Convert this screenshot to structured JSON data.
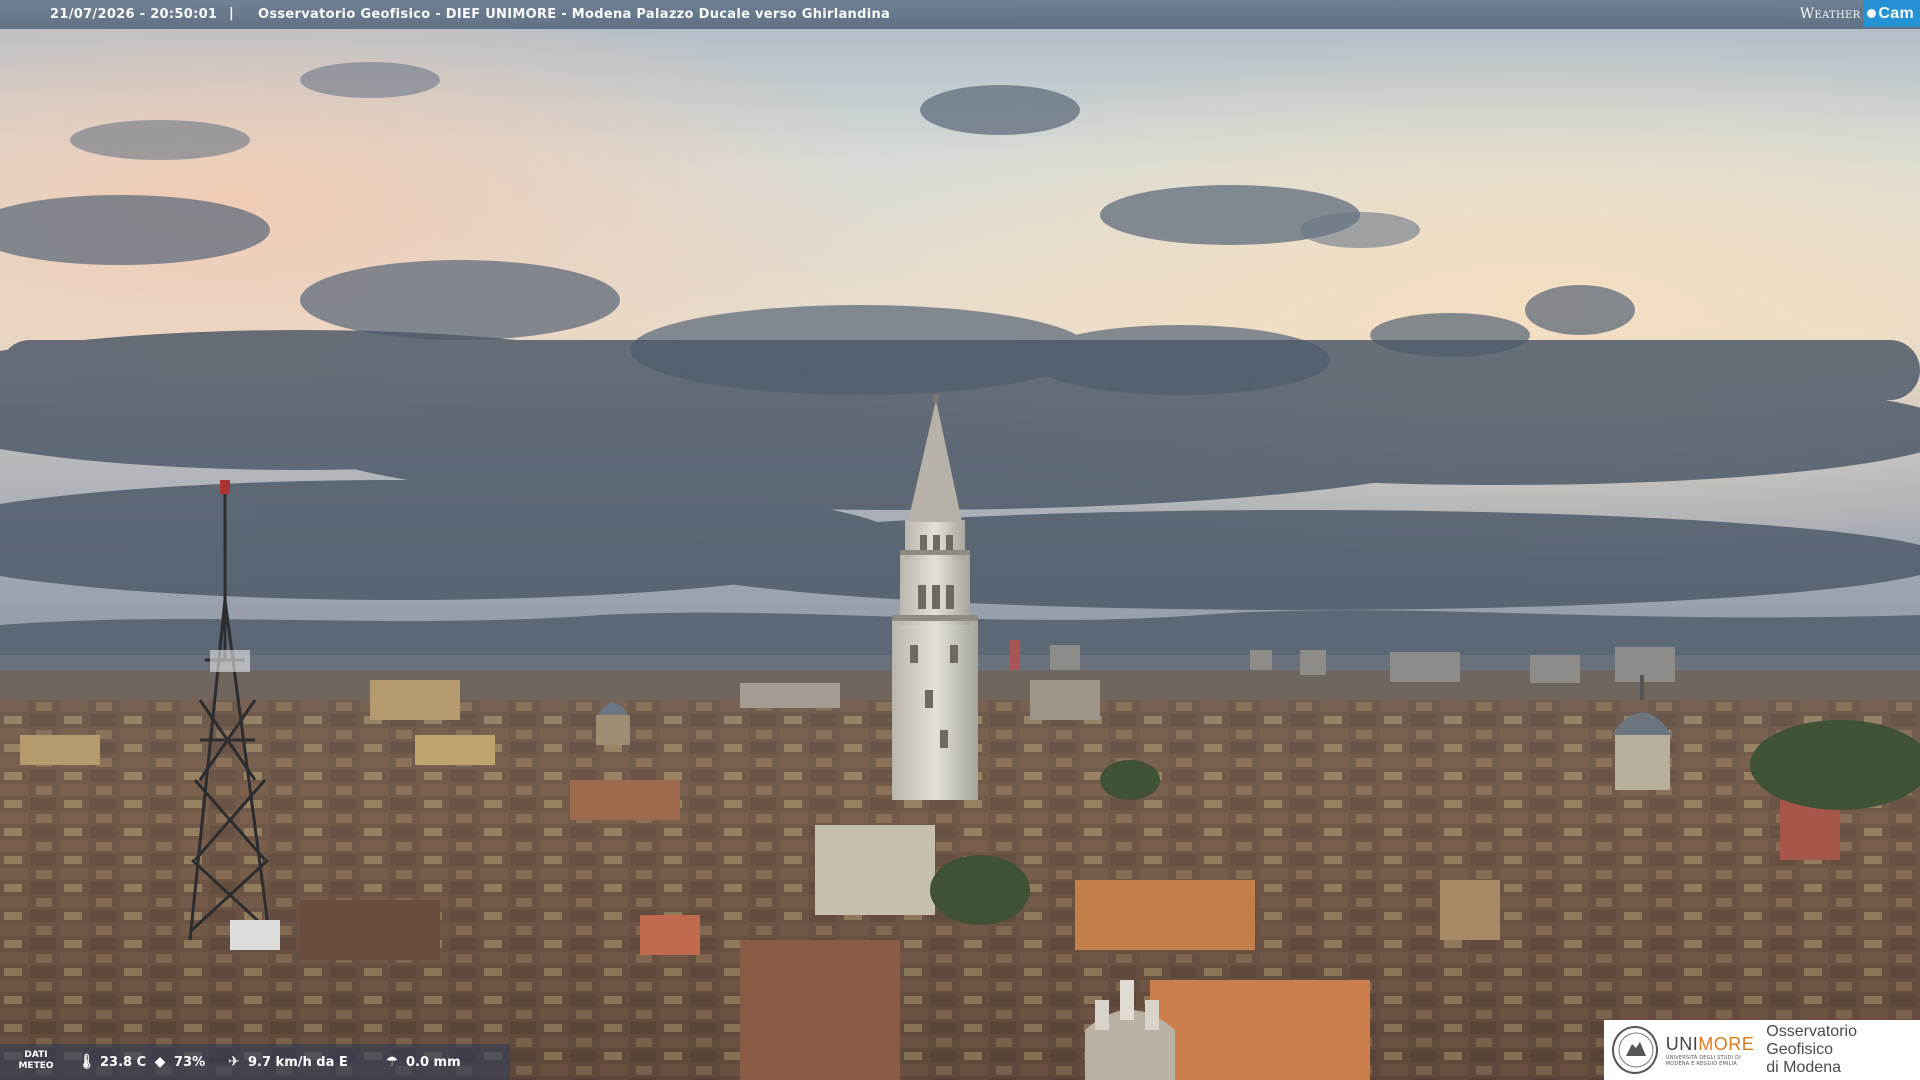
{
  "header": {
    "datetime": "21/07/2026 - 20:50:01",
    "separator": "|",
    "location": "Osservatorio Geofisico - DIEF UNIMORE - Modena Palazzo Ducale verso Ghirlandina",
    "brand_weather": "Weather",
    "brand_cam": "Cam"
  },
  "meteo": {
    "tag": "DATI METEO",
    "tag_line1": "DATI",
    "tag_line2": "METEO",
    "temperature": "23.8 C",
    "humidity": "73%",
    "wind": "9.7 km/h da E",
    "rain": "0.0 mm",
    "icons": [
      "thermometer-icon",
      "humidity-drop-icon",
      "wind-icon",
      "rain-gauge-icon"
    ]
  },
  "logo": {
    "uni": "UNI",
    "more": "MORE",
    "subtitle1": "UNIVERSITÀ DEGLI STUDI DI",
    "subtitle2": "MODENA E REGGIO EMILIA",
    "name_line1": "Osservatorio Geofisico",
    "name_line2": "di Modena"
  },
  "colors": {
    "bar": "#5f6f85",
    "cam_accent": "#1b8fd6",
    "unimore_orange": "#e07a1f"
  }
}
